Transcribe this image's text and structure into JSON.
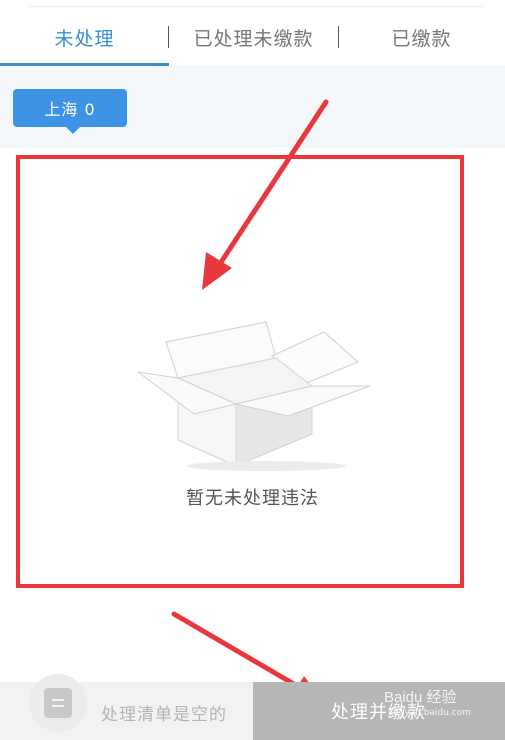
{
  "tabs": [
    {
      "label": "未处理",
      "active": true
    },
    {
      "label": "已处理未缴款",
      "active": false
    },
    {
      "label": "已缴款",
      "active": false
    }
  ],
  "city_filter": {
    "label": "上海 0"
  },
  "empty_state": {
    "message": "暂无未处理违法"
  },
  "bottom_bar": {
    "cart_text": "处理清单是空的",
    "pay_button_label": "处理并缴款"
  },
  "watermark": {
    "main": "Baidu 经验",
    "sub": "jingyan.baidu.com"
  },
  "colors": {
    "accent": "#3a8fd0",
    "badge": "#3d93e6",
    "highlight": "#e8373d",
    "button_disabled": "#b6b6b6"
  }
}
